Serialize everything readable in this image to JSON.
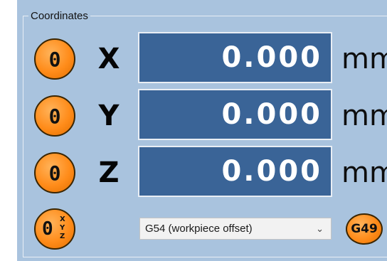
{
  "group": {
    "title": "Coordinates"
  },
  "axes": [
    {
      "zero_label": "0",
      "axis": "X",
      "value": "0.000",
      "unit": "mm"
    },
    {
      "zero_label": "0",
      "axis": "Y",
      "value": "0.000",
      "unit": "mm"
    },
    {
      "zero_label": "0",
      "axis": "Z",
      "value": "0.000",
      "unit": "mm"
    }
  ],
  "zero_all": {
    "glyph": "0",
    "x": "X",
    "y": "Y",
    "z": "Z"
  },
  "offset_select": {
    "value": "G54 (workpiece offset)",
    "chevron": "⌄"
  },
  "g49_button": {
    "label": "G49"
  },
  "colors": {
    "panel": "#a9c3de",
    "dro_background": "#3a6497",
    "button_orange": "#ff8c1a"
  },
  "icons": {
    "zero_axis": "zero-axis-icon",
    "zero_all": "zero-all-axes-icon",
    "dropdown": "chevron-down-icon"
  }
}
